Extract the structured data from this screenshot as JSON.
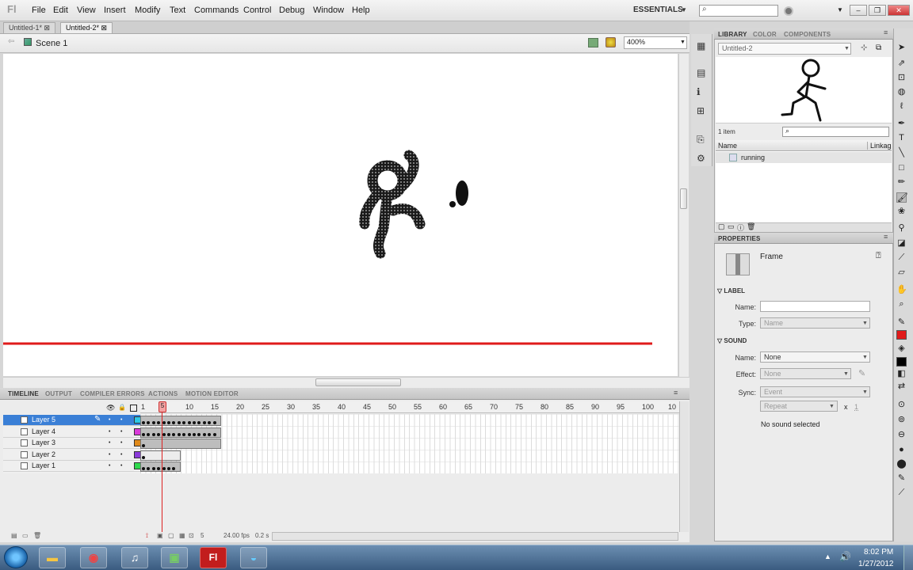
{
  "menu": {
    "logo": "Fl",
    "items": [
      "File",
      "Edit",
      "View",
      "Insert",
      "Modify",
      "Text",
      "Commands",
      "Control",
      "Debug",
      "Window",
      "Help"
    ],
    "workspace": "ESSENTIALS",
    "search_placeholder": ""
  },
  "document_tabs": [
    {
      "label": "Untitled-1*",
      "active": false
    },
    {
      "label": "Untitled-2*",
      "active": true
    }
  ],
  "edit_bar": {
    "scene": "Scene 1",
    "zoom": "400%"
  },
  "stage": {
    "guide_line_color": "#e01b1b"
  },
  "timeline": {
    "tabs": [
      "TIMELINE",
      "OUTPUT",
      "COMPILER ERRORS",
      "ACTIONS",
      "MOTION EDITOR"
    ],
    "ruler": [
      "1",
      "5",
      "10",
      "15",
      "20",
      "25",
      "30",
      "35",
      "40",
      "45",
      "50",
      "55",
      "60",
      "65",
      "70",
      "75",
      "80",
      "85",
      "90",
      "95",
      "100",
      "10"
    ],
    "playhead_frame": "5",
    "layers": [
      {
        "name": "Layer 5",
        "color": "#2ec8e6",
        "active": true
      },
      {
        "name": "Layer 4",
        "color": "#d93bd9",
        "active": false
      },
      {
        "name": "Layer 3",
        "color": "#e08a1a",
        "active": false
      },
      {
        "name": "Layer 2",
        "color": "#8a3bd9",
        "active": false
      },
      {
        "name": "Layer 1",
        "color": "#2ed94d",
        "active": false
      }
    ],
    "status": {
      "current_frame": "5",
      "fps": "24.00 fps",
      "time": "0.2 s"
    }
  },
  "library": {
    "tabs": [
      "LIBRARY",
      "COLOR",
      "COMPONENTS"
    ],
    "document": "Untitled-2",
    "item_count": "1 item",
    "columns": [
      "Name",
      "Linkag"
    ],
    "items": [
      {
        "name": "running"
      }
    ]
  },
  "properties": {
    "tab": "PROPERTIES",
    "type": "Frame",
    "label_section": "LABEL",
    "name_label": "Name:",
    "name_value": "",
    "type_label": "Type:",
    "type_value": "Name",
    "sound_section": "SOUND",
    "sound_name_label": "Name:",
    "sound_name_value": "None",
    "effect_label": "Effect:",
    "effect_value": "None",
    "sync_label": "Sync:",
    "sync_value": "Event",
    "repeat_value": "Repeat",
    "repeat_x": "x",
    "repeat_count": "1",
    "no_sound": "No sound selected"
  },
  "tools": {
    "stroke_color": "#e01b1b",
    "fill_color": "#000000"
  },
  "taskbar": {
    "time": "8:02 PM",
    "date": "1/27/2012",
    "flash_glyph": "Fl"
  }
}
